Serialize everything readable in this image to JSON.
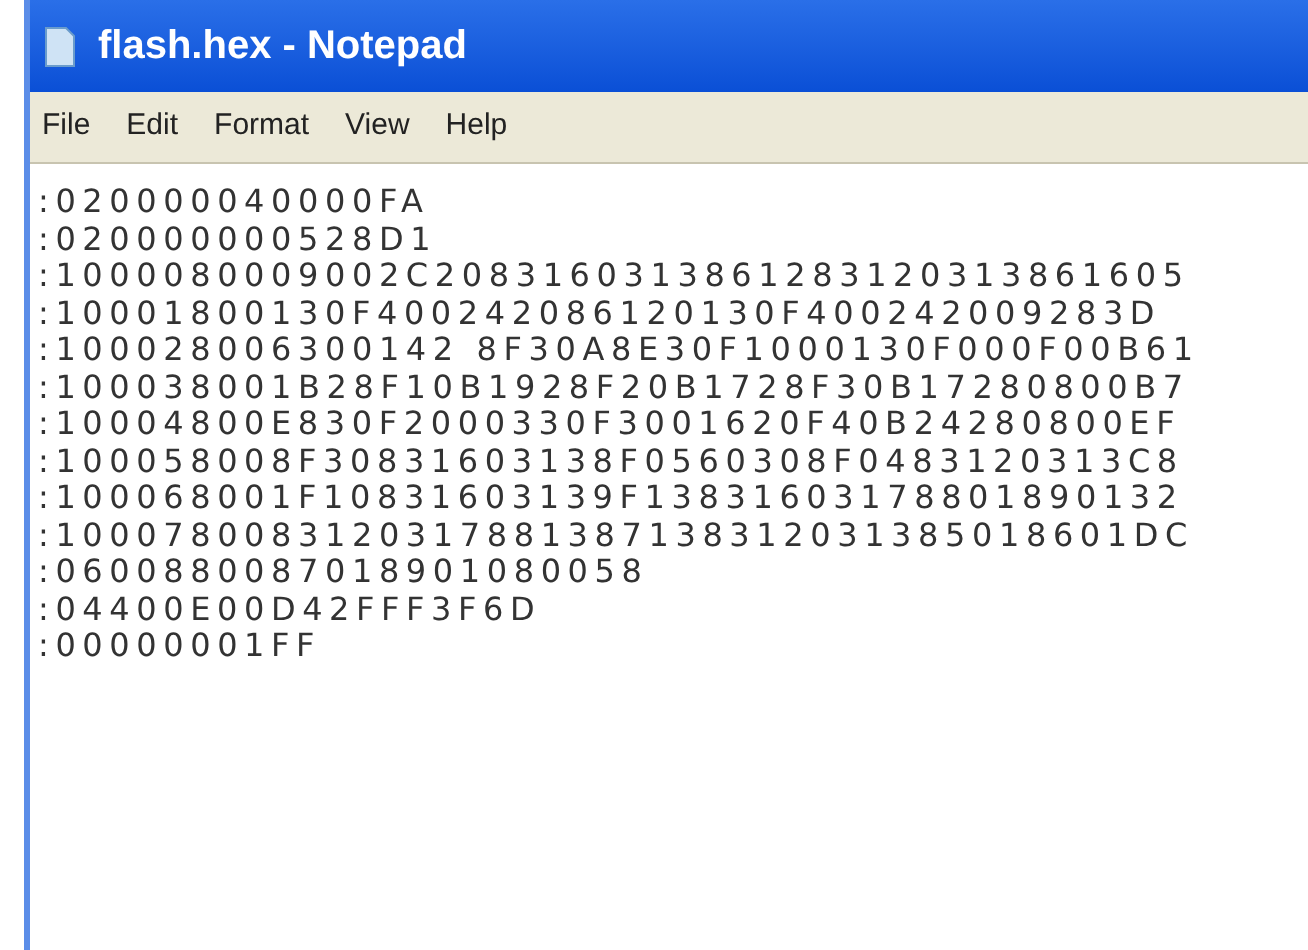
{
  "window": {
    "title": "flash.hex - Notepad"
  },
  "menu": [
    "File",
    "Edit",
    "Format",
    "View",
    "Help"
  ],
  "lines": [
    ":020000040000FA",
    ":020000000528D1",
    ":1000080009002C2083160313861283120313861605",
    ":10001800130F400242086120130F400242009283D",
    ":100028006300142 8F30A8E30F1000130F000F00B61",
    ":100038001B28F10B1928F20B1728F30B17280800B7",
    ":10004800E830F2000330F3001620F40B24280800EF",
    ":100058008F30831603138F0560308F0483120313C8",
    ":100068001F10831603139F13831603178801890132",
    ":1000780083120317881387138312031385018601DC",
    ":0600880087018901080058",
    ":04400E00D42FFF3F6D",
    ":00000001FF"
  ]
}
